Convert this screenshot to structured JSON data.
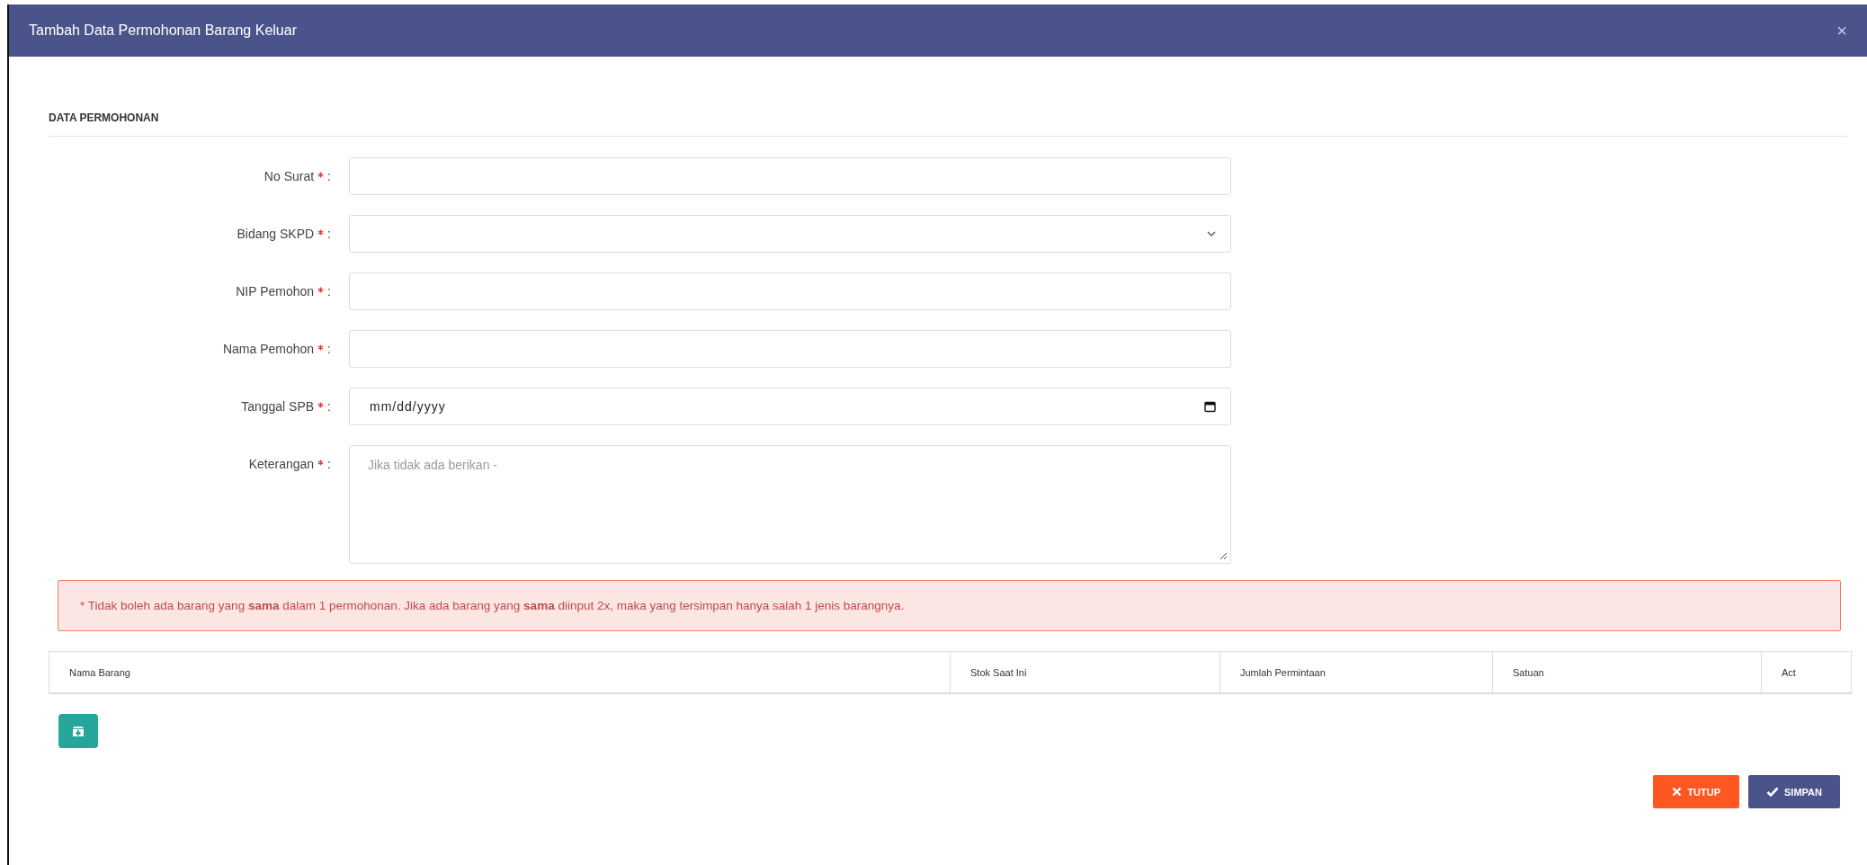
{
  "modal": {
    "title": "Tambah Data Permohonan Barang Keluar",
    "close": "×"
  },
  "section": {
    "title": "DATA PERMOHONAN"
  },
  "label_separator": ":",
  "fields": [
    {
      "kind": "text",
      "label": "No Surat",
      "required": true
    },
    {
      "kind": "select",
      "label": "Bidang SKPD",
      "required": true
    },
    {
      "kind": "text",
      "label": "NIP Pemohon",
      "required": true
    },
    {
      "kind": "text",
      "label": "Nama Pemohon",
      "required": true
    },
    {
      "kind": "date",
      "label": "Tanggal SPB",
      "required": true,
      "placeholder": "mm/dd/yyyy"
    },
    {
      "kind": "textarea",
      "label": "Keterangan",
      "required": true,
      "placeholder": "Jika tidak ada berikan -"
    }
  ],
  "alert": {
    "text": "* Tidak boleh ada barang yang **sama** dalam 1 permohonan. Jika ada barang yang **sama** diinput 2x, maka yang tersimpan hanya salah 1 jenis barangnya."
  },
  "table": {
    "columns": [
      "Nama Barang",
      "Stok Saat Ini",
      "Jumlah Permintaan",
      "Satuan",
      "Act"
    ]
  },
  "buttons": [
    {
      "kind": "close",
      "label": "TUTUP"
    },
    {
      "kind": "save",
      "label": "SIMPAN"
    }
  ]
}
